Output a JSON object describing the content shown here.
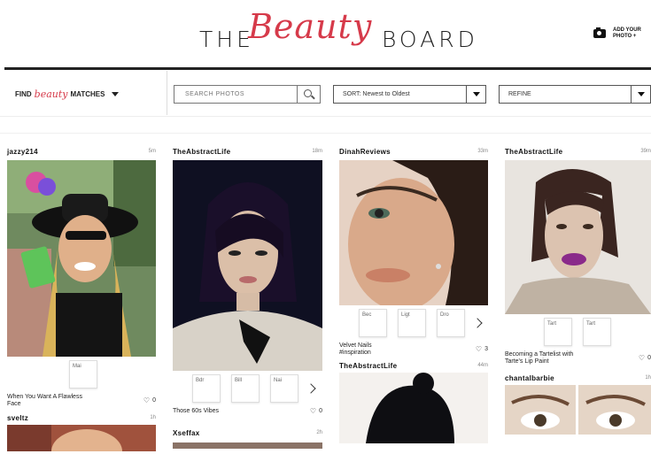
{
  "header": {
    "logo_the": "THE",
    "logo_beauty": "Beauty",
    "logo_board": "BOARD",
    "add_photo": "ADD YOUR PHOTO +"
  },
  "filters": {
    "find_prefix": "FIND",
    "find_script": "beauty",
    "find_suffix": "MATCHES",
    "search_placeholder": "SEARCH PHOTOS",
    "sort_value": "SORT: Newest to Oldest",
    "refine_value": "REFINE"
  },
  "cards": [
    {
      "user": "jazzy214",
      "time": "5m",
      "thumbs": [
        "Mai"
      ],
      "caption": "When You Want A Flawless Face",
      "likes": "0",
      "next_user": "sveltz",
      "next_time": "1h"
    },
    {
      "user": "TheAbstractLife",
      "time": "18m",
      "thumbs": [
        "Bdr",
        "Bill",
        "Nai"
      ],
      "caption": "Those 60s Vibes",
      "likes": "0",
      "next_user": "Xseffax",
      "next_time": "2h"
    },
    {
      "user": "DinahReviews",
      "time": "33m",
      "thumbs": [
        "Bec",
        "Ligt",
        "Dro"
      ],
      "caption": "Velvet Nails #inspiration",
      "likes": "3",
      "next_user": "TheAbstractLife",
      "next_time": "44m"
    },
    {
      "user": "TheAbstractLife",
      "time": "39m",
      "thumbs": [
        "Tart",
        "Tart"
      ],
      "caption": "Becoming a Tartelist with Tarte's Lip Paint",
      "likes": "0",
      "next_user": "chantalbarbie",
      "next_time": "1h"
    }
  ],
  "colors": {
    "accent": "#d63a4a",
    "rule": "#222222"
  }
}
